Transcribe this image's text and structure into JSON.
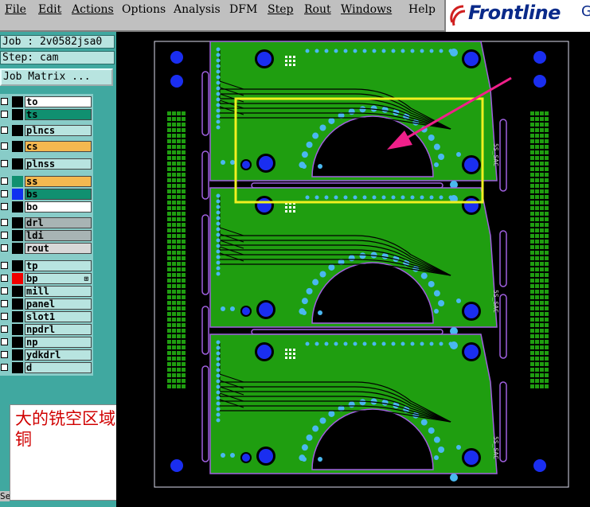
{
  "menu": [
    "File",
    "Edit",
    "Actions",
    "Options",
    "Analysis",
    "DFM",
    "Step",
    "Rout",
    "Windows",
    "Help"
  ],
  "brand": {
    "name": "Frontline",
    "tail": "G",
    "color": "#0a2a8a",
    "logo_mark": "red-curl-logo"
  },
  "job": {
    "job_label": "Job : 2v0582jsa0",
    "step_label": "Step: cam",
    "matrix_button": "Job Matrix ..."
  },
  "layers": [
    {
      "name": "to",
      "color": "#ffffff",
      "swatch": "#000000"
    },
    {
      "name": "ts",
      "color": "#109070",
      "swatch": "#000000"
    },
    {
      "name": "plncs",
      "color": "#b8e4e0",
      "swatch": "#000000"
    },
    {
      "name": "cs",
      "color": "#f4b850",
      "swatch": "#000000"
    },
    {
      "name": "plnss",
      "color": "#b8e4e0",
      "swatch": "#000000"
    },
    {
      "name": "ss",
      "color": "#f4b850",
      "swatch": "#109070"
    },
    {
      "name": "bs",
      "color": "#109070",
      "swatch": "#1030f0"
    },
    {
      "name": "bo",
      "color": "#ffffff",
      "swatch": "#000000"
    },
    {
      "name": "drl",
      "color": "#a8b4b4",
      "swatch": "#000000"
    },
    {
      "name": "ldi",
      "color": "#a8b4b4",
      "swatch": "#000000"
    },
    {
      "name": "rout",
      "color": "#d8d8d8",
      "swatch": "#000000"
    },
    {
      "name": "tp",
      "color": "#b8e4e0",
      "swatch": "#000000"
    },
    {
      "name": "bp",
      "color": "#b8e4e0",
      "swatch": "#f00000",
      "plus": "⊞"
    },
    {
      "name": "mill",
      "color": "#b8e4e0",
      "swatch": "#000000"
    },
    {
      "name": "panel",
      "color": "#b8e4e0",
      "swatch": "#000000"
    },
    {
      "name": "slot1",
      "color": "#b8e4e0",
      "swatch": "#000000"
    },
    {
      "name": "npdrl",
      "color": "#b8e4e0",
      "swatch": "#000000"
    },
    {
      "name": "np",
      "color": "#b8e4e0",
      "swatch": "#000000"
    },
    {
      "name": "ydkdrl",
      "color": "#b8e4e0",
      "swatch": "#000000"
    },
    {
      "name": "d",
      "color": "#b8e4e0",
      "swatch": "#000000"
    }
  ],
  "annotation": {
    "text": "大的铣空区域没有铺铜",
    "color": "#d00000"
  },
  "status": {
    "partial_label": "Se"
  },
  "colors": {
    "copper": "#1f9e10",
    "pad": "#1a2ef0",
    "via": "#4ab8f0",
    "trace": "#000000",
    "outline": "#a060e0",
    "highlight": "#f0f020",
    "arrow": "#f0208a",
    "background": "#000000"
  },
  "board": {
    "silk_text": "5S_SAC"
  }
}
